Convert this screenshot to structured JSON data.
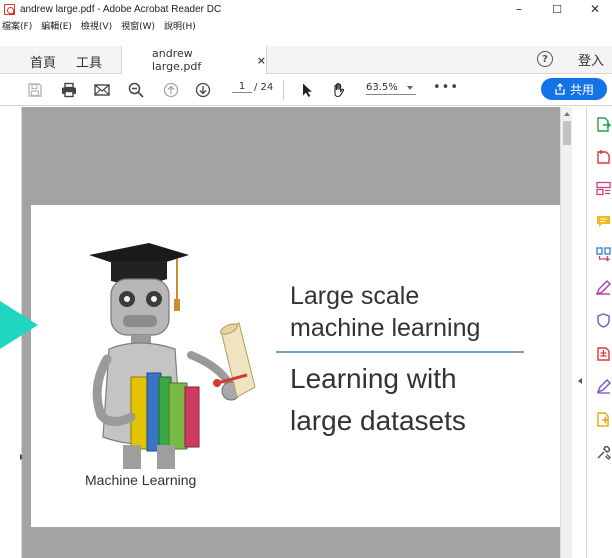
{
  "window": {
    "title": "andrew large.pdf - Adobe Acrobat Reader DC",
    "minimize": "–",
    "maximize": "☐",
    "close": "✕"
  },
  "menu": [
    "檔案(F)",
    "編輯(E)",
    "檢視(V)",
    "視窗(W)",
    "說明(H)"
  ],
  "tabs": {
    "home": "首頁",
    "tools": "工具",
    "document": "andrew large.pdf",
    "close": "×",
    "help": "?",
    "signin": "登入"
  },
  "toolbar": {
    "current_page": "1",
    "total_pages": "/ 24",
    "zoom": "63.5%",
    "more": "•••",
    "share": "共用",
    "icons": [
      "save-icon",
      "print-icon",
      "email-icon",
      "zoom-out-icon",
      "page-up-icon",
      "page-down-icon",
      "select-cursor-icon",
      "hand-tool-icon"
    ]
  },
  "slide": {
    "title_line1": "Large scale",
    "title_line2": "machine learning",
    "subtitle_line1": "Learning with",
    "subtitle_line2": "large datasets",
    "caption": "Machine Learning"
  },
  "right_pane": {
    "icons": [
      "export-pdf-icon",
      "create-pdf-icon",
      "edit-pdf-icon",
      "comment-icon",
      "organize-pages-icon",
      "fill-sign-icon",
      "protect-icon",
      "send-for-review-icon",
      "sign-icon",
      "more-tools-icon",
      "customize-tools-icon"
    ]
  },
  "colors": {
    "accent": "#1473e6",
    "pointer": "#1fd6c0",
    "doc_background": "#a3a3a3",
    "divider": "#7ba2c9"
  }
}
